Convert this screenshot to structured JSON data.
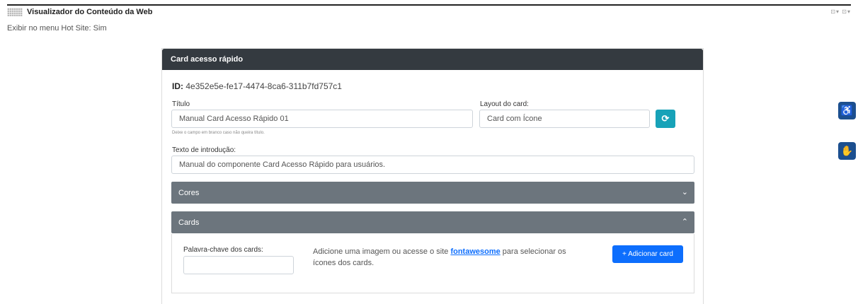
{
  "app": {
    "title": "Visualizador do Conteúdo da Web",
    "top_right": "⊡▾ ⊡▾"
  },
  "hotsite": "Exibir no menu Hot Site: Sim",
  "card": {
    "header": "Card acesso rápido",
    "id_label": "ID:",
    "id_value": "4e352e5e-fe17-4474-8ca6-311b7fd757c1",
    "titulo_label": "Título",
    "titulo_value": "Manual Card Acesso Rápido 01",
    "titulo_hint": "Deixe o campo em branco caso não queira título.",
    "layout_label": "Layout do card:",
    "layout_value": "Card com Ícone",
    "intro_label": "Texto de introdução:",
    "intro_value": "Manual do componente Card Acesso Rápido para usuários."
  },
  "sections": {
    "cores": "Cores",
    "cards": "Cards"
  },
  "cards_section": {
    "keyword_label": "Palavra-chave dos cards:",
    "keyword_value": "",
    "info_before": "Adicione uma imagem ou acesse o site ",
    "info_link": "fontawesome",
    "info_after": " para selecionar os ícones dos cards.",
    "add_button": "+ Adicionar card"
  },
  "icons": {
    "refresh": "refresh-icon",
    "accessibility": "accessibility-icon",
    "sign_language": "sign-language-icon"
  }
}
